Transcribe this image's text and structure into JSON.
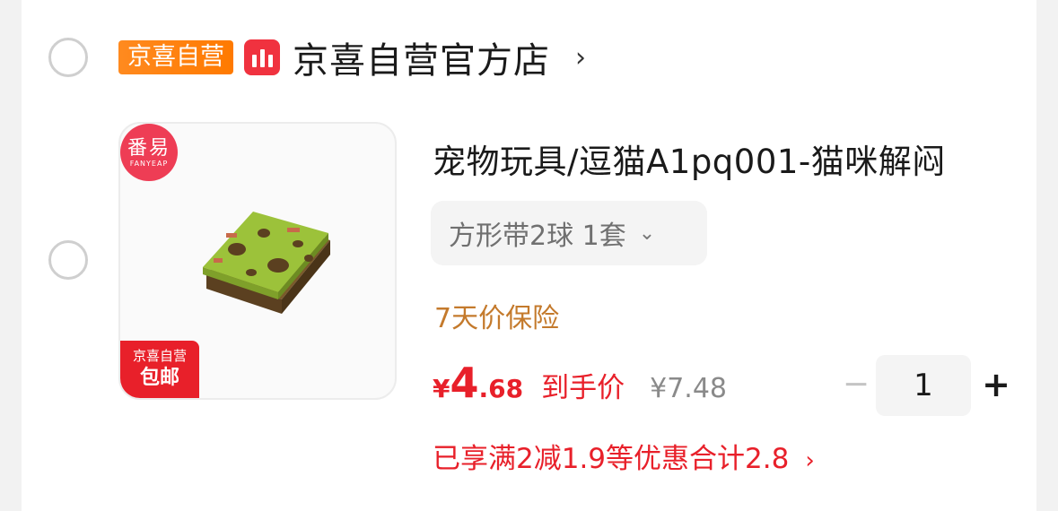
{
  "shop": {
    "tag": "京喜自营",
    "name": "京喜自营官方店",
    "arrow": "›",
    "icon": "store-bars-icon",
    "icon_color": "#f0323f"
  },
  "product": {
    "thumbnail": {
      "brand_top": "番易",
      "brand_bottom": "FANYEAP",
      "tag_line1": "京喜自营",
      "tag_line2": "包邮"
    },
    "title": "宠物玩具/逗猫A1pq001-猫咪解闷",
    "variant": "方形带2球 1套",
    "variant_chevron": "⌄",
    "insurance": "7天价保险",
    "price": {
      "currency": "¥",
      "integer": "4",
      "decimal": ".68",
      "label": "到手价",
      "original": "¥7.48"
    },
    "quantity": {
      "minus": "−",
      "value": "1",
      "plus": "+"
    },
    "promo": {
      "text": "已享满2减1.9等优惠合计2.8",
      "arrow": "›"
    }
  },
  "colors": {
    "accent_red": "#e8202a",
    "tag_orange": "#ff7a00",
    "insurance_brown": "#c47a2c"
  }
}
